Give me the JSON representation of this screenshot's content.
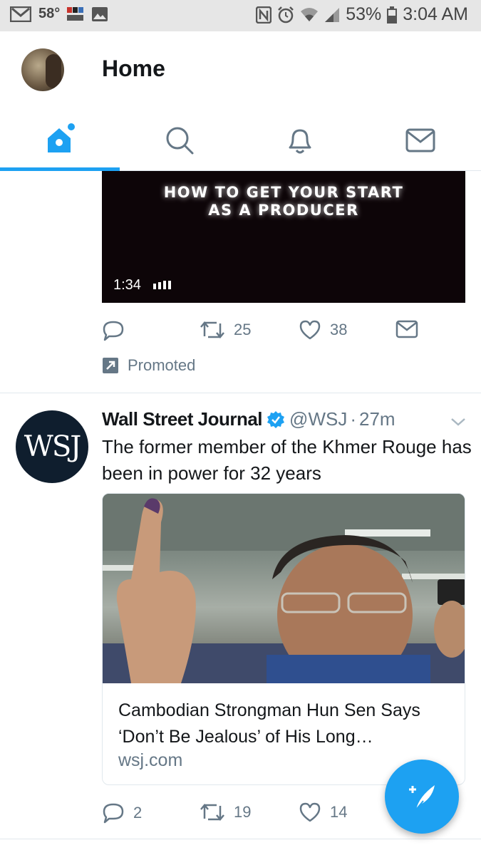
{
  "status_bar": {
    "temperature": "58°",
    "battery": "53%",
    "time": "3:04 AM",
    "icons": [
      "gmail-icon",
      "npr-news-icon",
      "gallery-icon",
      "nfc-icon",
      "alarm-icon",
      "wifi-icon",
      "signal-icon",
      "battery-icon"
    ]
  },
  "header": {
    "title": "Home"
  },
  "tabs": [
    {
      "name": "home",
      "icon": "home-icon",
      "active": true
    },
    {
      "name": "search",
      "icon": "search-icon",
      "active": false
    },
    {
      "name": "notifications",
      "icon": "bell-icon",
      "active": false
    },
    {
      "name": "messages",
      "icon": "mail-icon",
      "active": false
    }
  ],
  "promoted_tweet": {
    "video_title": "HOW TO GET YOUR START\nAS A PRODUCER",
    "duration": "1:34",
    "retweets": "25",
    "likes": "38",
    "promoted_label": "Promoted"
  },
  "tweet": {
    "avatar_text": "WSJ",
    "name": "Wall Street Journal",
    "handle": "@WSJ",
    "time": "27m",
    "text": "The former member of the Khmer Rouge has been in power for 32 years",
    "card": {
      "title": "Cambodian Strongman Hun Sen Says ‘Don’t Be Jealous’ of His Long…",
      "domain": "wsj.com"
    },
    "replies": "2",
    "retweets": "19",
    "likes": "14"
  },
  "colors": {
    "accent": "#1da1f2",
    "text": "#14171a",
    "muted": "#657786",
    "divider": "#e1e8ed"
  }
}
